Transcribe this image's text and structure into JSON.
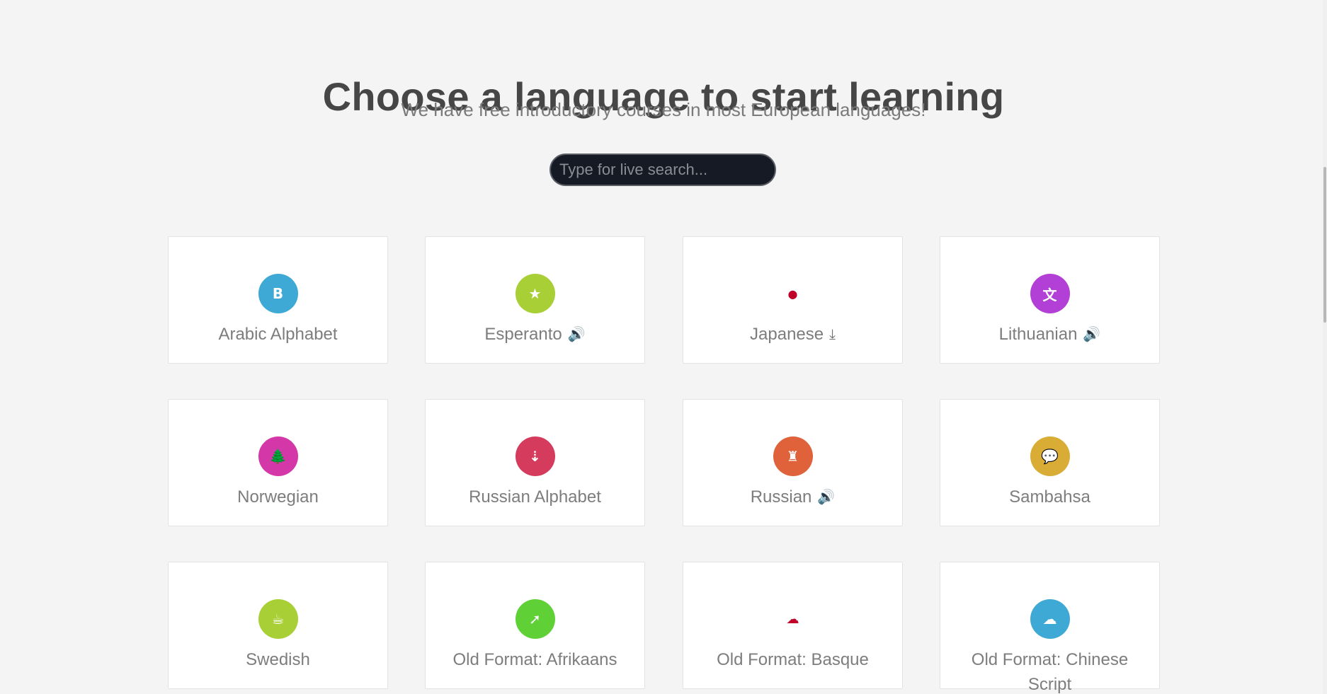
{
  "header": {
    "title": "Choose a language to start learning",
    "subtitle": "We have free introductory courses in most European languages!"
  },
  "search": {
    "placeholder": "Type for live search..."
  },
  "courses": [
    {
      "label": "Arabic Alphabet",
      "icon": "letter-b-icon",
      "glyph": "B",
      "color": "#3ea9d4",
      "extra": ""
    },
    {
      "label": "Esperanto",
      "icon": "star-icon",
      "glyph": "★",
      "color": "#a8cf35",
      "extra": "speaker-icon"
    },
    {
      "label": "Japanese",
      "icon": "japan-flag-dot-icon",
      "glyph": "●",
      "color": "#c1002a",
      "extra": "download-icon"
    },
    {
      "label": "Lithuanian",
      "icon": "translate-icon",
      "glyph": "文",
      "color": "#b23fd6",
      "extra": "speaker-icon"
    },
    {
      "label": "Norwegian",
      "icon": "tree-icon",
      "glyph": "🌲",
      "color": "#d438a8",
      "extra": ""
    },
    {
      "label": "Russian Alphabet",
      "icon": "sort-alpha-icon",
      "glyph": "⇣",
      "color": "#d43b5c",
      "extra": ""
    },
    {
      "label": "Russian",
      "icon": "castle-icon",
      "glyph": "♜",
      "color": "#e0623a",
      "extra": "speaker-icon"
    },
    {
      "label": "Sambahsa",
      "icon": "chat-bubble-icon",
      "glyph": "💬",
      "color": "#d9ac35",
      "extra": ""
    },
    {
      "label": "Swedish",
      "icon": "coffee-cup-icon",
      "glyph": "☕",
      "color": "#a8cf35",
      "extra": ""
    },
    {
      "label": "Old Format: Afrikaans",
      "icon": "rocket-icon",
      "glyph": "➚",
      "color": "#5fd136",
      "extra": ""
    },
    {
      "label": "Old Format: Basque",
      "icon": "cloud-icon",
      "glyph": "☁",
      "color": "#c1002a",
      "extra": ""
    },
    {
      "label": "Old Format: Chinese Script",
      "icon": "cloud-icon",
      "glyph": "☁",
      "color": "#3ea9d4",
      "extra": ""
    }
  ],
  "extras": {
    "speaker-icon": "🔊",
    "download-icon": "⤓"
  }
}
